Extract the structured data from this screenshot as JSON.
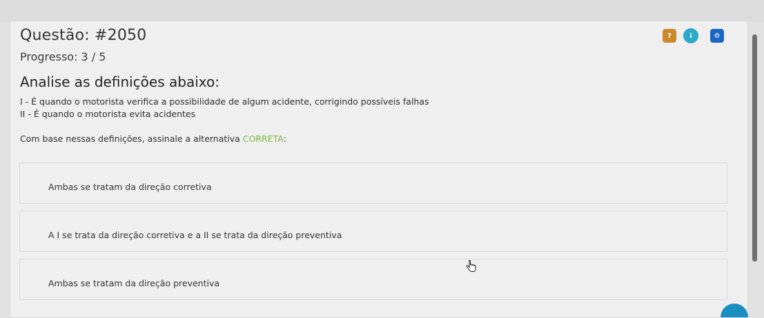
{
  "question": {
    "title": "Questão: #2050",
    "progress": "Progresso: 3 / 5",
    "heading": "Analise as definições abaixo:",
    "definitions": [
      "I - É quando o motorista verifica a possibilidade de algum acidente, corrigindo possíveis falhas",
      "II - É quando o motorista evita acidentes"
    ],
    "instruction_prefix": "Com base nessas definições, assinale a alternativa ",
    "instruction_highlight": "CORRETA",
    "instruction_suffix": ":"
  },
  "header_icons": {
    "help": "?",
    "info": "i",
    "settings": "⚙"
  },
  "options": [
    "Ambas se tratam da direção corretiva",
    "A I se trata da direção corretiva e a II se trata da direção preventiva",
    "Ambas se tratam da direção preventiva"
  ],
  "colors": {
    "highlight": "#7bb243",
    "help_button": "#c98a2c",
    "info_button": "#2ba9c8",
    "settings_button": "#1b66c4"
  }
}
